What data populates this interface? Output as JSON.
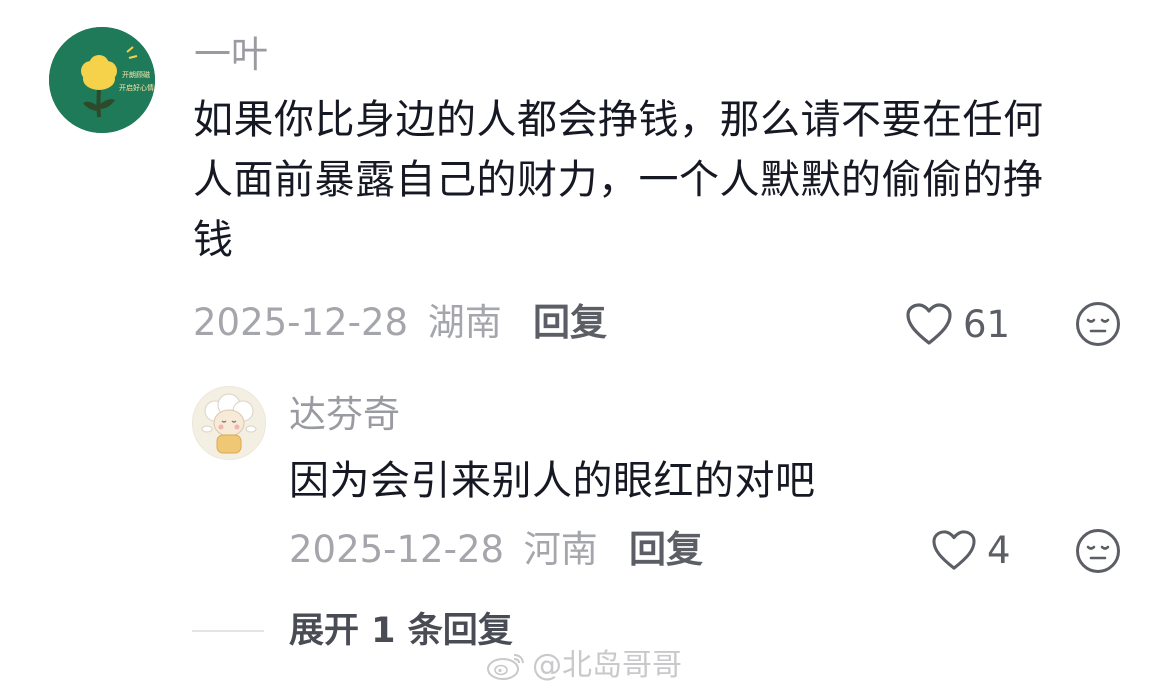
{
  "comment": {
    "username": "一叶",
    "avatar_text": [
      "开朗顾磁",
      "开启好心情"
    ],
    "text_lines": [
      "如果你比身边的人都会挣钱，那么请不要在任何",
      "人面前暴露自己的财力，一个人默默的偷偷的挣",
      "钱"
    ],
    "timestamp": "2025-12-28",
    "location": "湖南",
    "reply_label": "回复",
    "like_count": "61"
  },
  "reply": {
    "username": "达芬奇",
    "text": "因为会引来别人的眼红的对吧",
    "timestamp": "2025-12-28",
    "location": "河南",
    "reply_label": "回复",
    "like_count": "4"
  },
  "expand_label": "展开 1 条回复",
  "watermark": "@北岛哥哥",
  "colors": {
    "avatar_bg": "#1f7a5a",
    "text": "#161823",
    "muted": "#9a9ba1",
    "icon": "#5c5e66"
  }
}
